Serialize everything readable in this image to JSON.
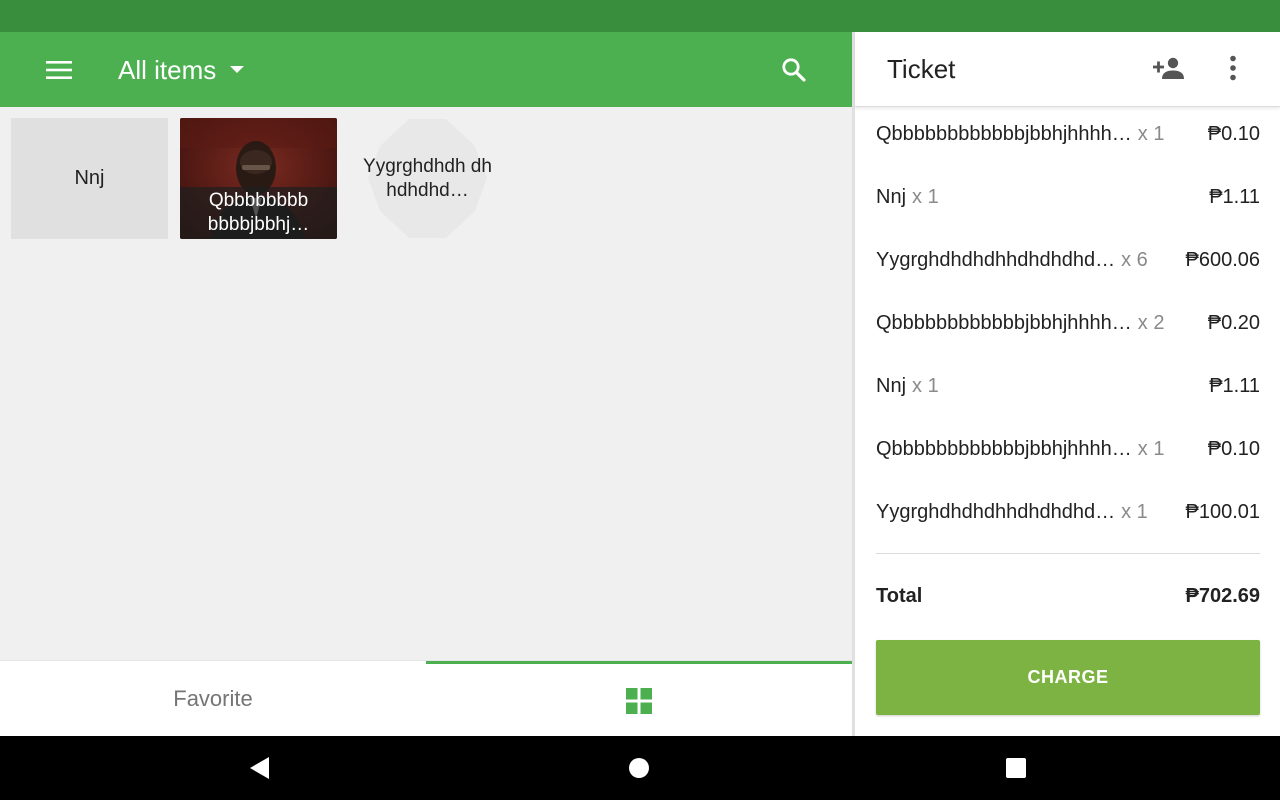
{
  "toolbar": {
    "category": "All items",
    "menu_icon": "menu-icon",
    "search_icon": "search-icon",
    "accent_color": "#4caf50"
  },
  "items": [
    {
      "name": "Nnj"
    },
    {
      "name": "Qbbbbbbbb bbbbjbbhj…"
    },
    {
      "name": "Yygrghdhdh dhhdhdhd…"
    }
  ],
  "tabs": {
    "favorite_label": "Favorite",
    "grid_icon": "grid-icon"
  },
  "ticket": {
    "title": "Ticket",
    "add_customer_icon": "person-add-icon",
    "more_icon": "more-vert-icon",
    "lines": [
      {
        "name": "Qbbbbbbbbbbbbjbbhjhhhh…",
        "qty": "x 1",
        "price": "₱0.10"
      },
      {
        "name": "Nnj",
        "qty": "x 1",
        "price": "₱1.11"
      },
      {
        "name": "Yygrghdhdhdhhdhdhdhd…",
        "qty": "x 6",
        "price": "₱600.06"
      },
      {
        "name": "Qbbbbbbbbbbbbjbbhjhhhh…",
        "qty": "x 2",
        "price": "₱0.20"
      },
      {
        "name": "Nnj",
        "qty": "x 1",
        "price": "₱1.11"
      },
      {
        "name": "Qbbbbbbbbbbbbjbbhjhhhh…",
        "qty": "x 1",
        "price": "₱0.10"
      },
      {
        "name": "Yygrghdhdhdhhdhdhdhd…",
        "qty": "x 1",
        "price": "₱100.01"
      }
    ],
    "total_label": "Total",
    "total_value": "₱702.69",
    "charge_label": "CHARGE",
    "charge_color": "#7cb342"
  },
  "navbar": {
    "back_icon": "back-icon",
    "home_icon": "home-icon",
    "recents_icon": "recents-icon"
  }
}
